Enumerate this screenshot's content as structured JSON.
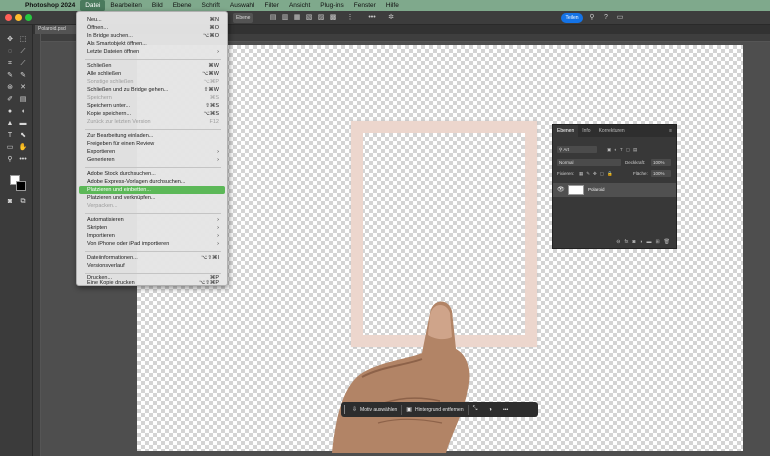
{
  "menubar": {
    "items": [
      "Photoshop 2024",
      "Datei",
      "Bearbeiten",
      "Bild",
      "Ebene",
      "Schrift",
      "Auswahl",
      "Filter",
      "Ansicht",
      "Plug-ins",
      "Fenster",
      "Hilfe"
    ]
  },
  "optionbar": {
    "layer_select": "Ebene",
    "share_label": "Teilen"
  },
  "document": {
    "tab_title": "Polaroid.psd"
  },
  "file_menu": {
    "groups": [
      [
        {
          "label": "Neu...",
          "shortcut": "⌘N",
          "disabled": false
        },
        {
          "label": "Öffnen...",
          "shortcut": "⌘O",
          "disabled": false
        },
        {
          "label": "In Bridge suchen...",
          "shortcut": "⌥⌘O",
          "disabled": false
        },
        {
          "label": "Als Smartobjekt öffnen...",
          "shortcut": "",
          "disabled": false
        },
        {
          "label": "Letzte Dateien öffnen",
          "shortcut": "›",
          "disabled": false
        }
      ],
      [
        {
          "label": "Schließen",
          "shortcut": "⌘W",
          "disabled": false
        },
        {
          "label": "Alle schließen",
          "shortcut": "⌥⌘W",
          "disabled": false
        },
        {
          "label": "Sonstige schließen",
          "shortcut": "⌥⌘P",
          "disabled": true
        },
        {
          "label": "Schließen und zu Bridge gehen...",
          "shortcut": "⇧⌘W",
          "disabled": false
        },
        {
          "label": "Speichern",
          "shortcut": "⌘S",
          "disabled": true
        },
        {
          "label": "Speichern unter...",
          "shortcut": "⇧⌘S",
          "disabled": false
        },
        {
          "label": "Kopie speichern...",
          "shortcut": "⌥⌘S",
          "disabled": false
        },
        {
          "label": "Zurück zur letzten Version",
          "shortcut": "F12",
          "disabled": true
        }
      ],
      [
        {
          "label": "Zur Bearbeitung einladen...",
          "shortcut": "",
          "disabled": false
        },
        {
          "label": "Freigeben für einen Review",
          "shortcut": "",
          "disabled": false
        },
        {
          "label": "Exportieren",
          "shortcut": "›",
          "disabled": false
        },
        {
          "label": "Generieren",
          "shortcut": "›",
          "disabled": false
        }
      ],
      [
        {
          "label": "Adobe Stock durchsuchen...",
          "shortcut": "",
          "disabled": false
        },
        {
          "label": "Adobe Express-Vorlagen durchsuchen...",
          "shortcut": "",
          "disabled": false
        },
        {
          "label": "Platzieren und einbetten...",
          "shortcut": "",
          "disabled": false,
          "highlighted": true
        },
        {
          "label": "Platzieren und verknüpfen...",
          "shortcut": "",
          "disabled": false
        },
        {
          "label": "Verpacken...",
          "shortcut": "",
          "disabled": true
        }
      ],
      [
        {
          "label": "Automatisieren",
          "shortcut": "›",
          "disabled": false
        },
        {
          "label": "Skripten",
          "shortcut": "›",
          "disabled": false
        },
        {
          "label": "Importieren",
          "shortcut": "›",
          "disabled": false
        },
        {
          "label": "Von iPhone oder iPad importieren",
          "shortcut": "›",
          "disabled": false
        }
      ],
      [
        {
          "label": "Dateiinformationen...",
          "shortcut": "⌥⇧⌘I",
          "disabled": false
        },
        {
          "label": "Versionsverlauf",
          "shortcut": "",
          "disabled": false
        }
      ],
      [
        {
          "label": "Drucken...",
          "shortcut": "⌘P",
          "disabled": false
        },
        {
          "label": "Eine Kopie drucken",
          "shortcut": "⌥⇧⌘P",
          "disabled": false
        }
      ]
    ]
  },
  "layers_panel": {
    "tabs": [
      "Ebenen",
      "Info",
      "Korrekturen"
    ],
    "filter_kind": "Art",
    "blend_mode": "Normal",
    "opacity_label": "Deckkraft:",
    "opacity_value": "100%",
    "lock_label": "Fixieren:",
    "fill_label": "Fläche:",
    "fill_value": "100%",
    "layer_name": "Polaroid"
  },
  "taskbar": {
    "select_subject": "Motiv auswählen",
    "remove_background": "Hintergrund entfernen",
    "more": "•••"
  },
  "colors": {
    "menubar_bg": "#7fa98c",
    "menu_highlight": "#5cb858",
    "share_blue": "#1473e6",
    "polaroid_frame": "#ecd6cd"
  }
}
